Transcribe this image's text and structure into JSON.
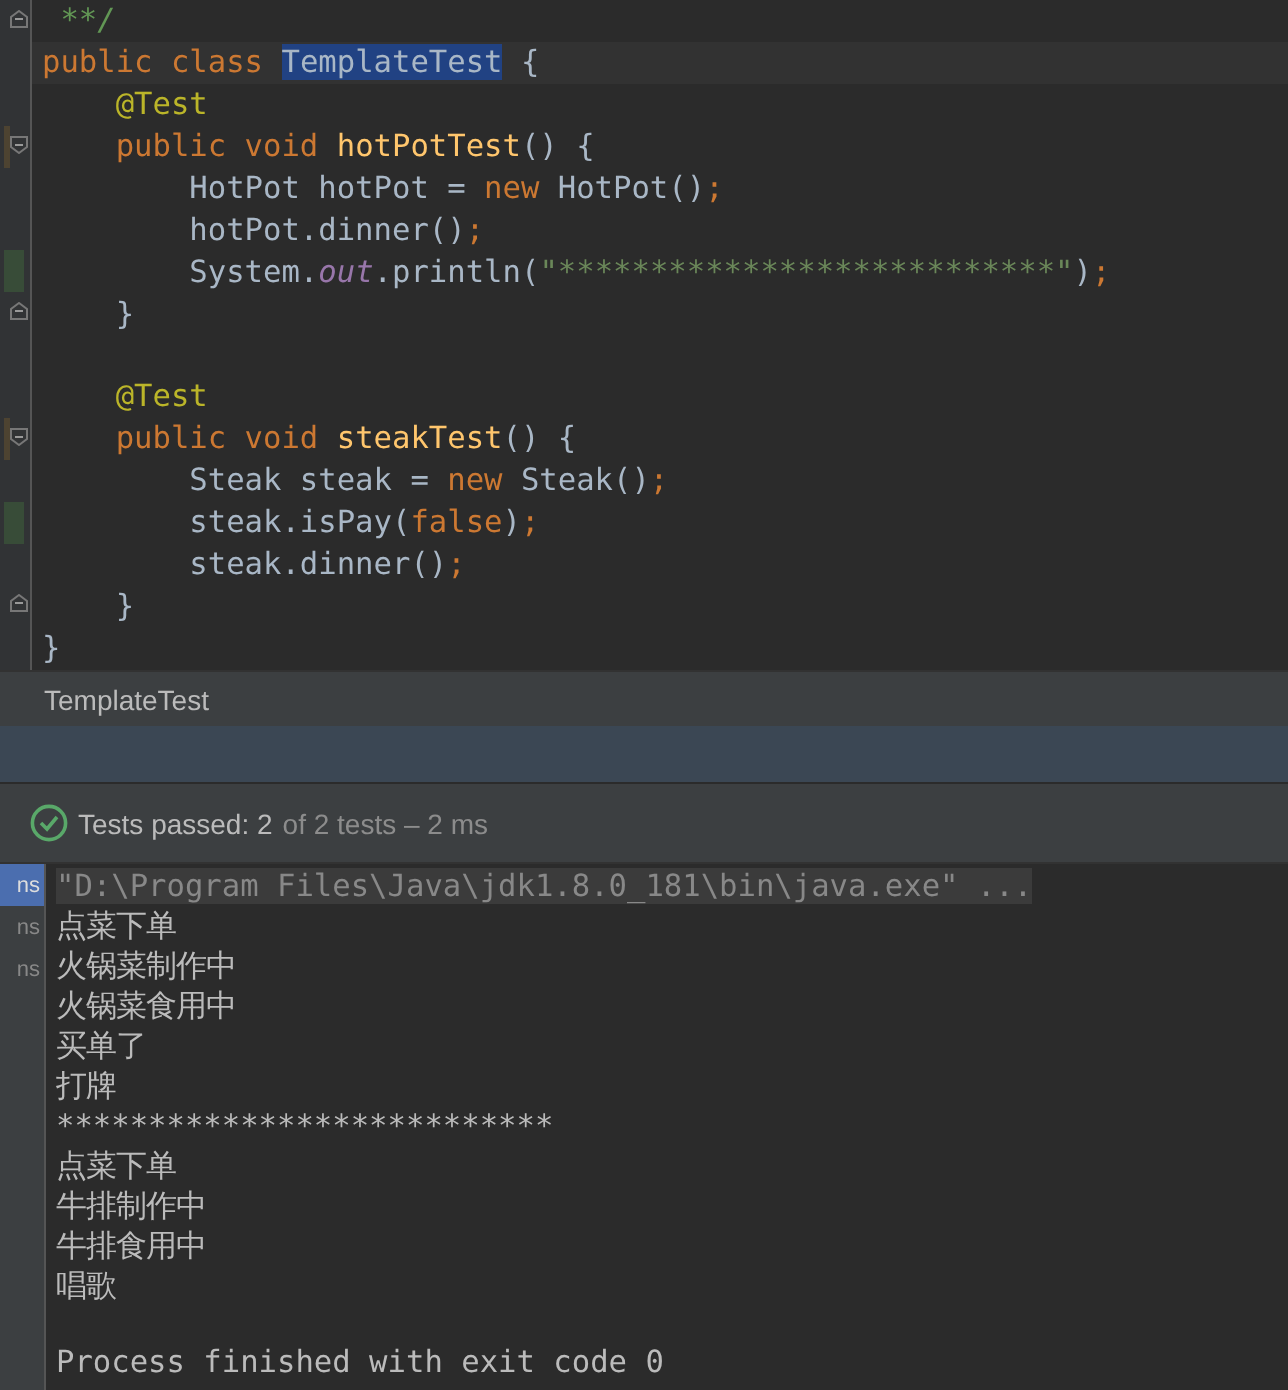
{
  "editor": {
    "lines": [
      {
        "current": false,
        "fold_start": false,
        "fold_end": true,
        "modified": false,
        "added": false,
        "tokens": [
          {
            "kind": "comment",
            "text": " **/"
          }
        ]
      },
      {
        "current": true,
        "fold_start": false,
        "fold_end": false,
        "modified": false,
        "added": false,
        "tokens": [
          {
            "kind": "kw",
            "text": "public class "
          },
          {
            "kind": "selected",
            "text": "TemplateTest"
          },
          {
            "kind": "plain",
            "text": " {"
          }
        ]
      },
      {
        "current": false,
        "fold_start": false,
        "fold_end": false,
        "modified": false,
        "added": false,
        "tokens": [
          {
            "kind": "annot",
            "text": "    @Test"
          }
        ]
      },
      {
        "current": false,
        "fold_start": true,
        "fold_end": false,
        "modified": true,
        "added": false,
        "tokens": [
          {
            "kind": "kw",
            "text": "    public void "
          },
          {
            "kind": "fn",
            "text": "hotPotTest"
          },
          {
            "kind": "plain",
            "text": "() {"
          }
        ]
      },
      {
        "current": false,
        "fold_start": false,
        "fold_end": false,
        "modified": false,
        "added": false,
        "tokens": [
          {
            "kind": "plain",
            "text": "        HotPot hotPot = "
          },
          {
            "kind": "kw",
            "text": "new "
          },
          {
            "kind": "plain",
            "text": "HotPot()"
          },
          {
            "kind": "kw",
            "text": ";"
          }
        ]
      },
      {
        "current": false,
        "fold_start": false,
        "fold_end": false,
        "modified": false,
        "added": false,
        "tokens": [
          {
            "kind": "plain",
            "text": "        hotPot.dinner()"
          },
          {
            "kind": "kw",
            "text": ";"
          }
        ]
      },
      {
        "current": false,
        "fold_start": false,
        "fold_end": false,
        "modified": false,
        "added": true,
        "tokens": [
          {
            "kind": "plain",
            "text": "        System."
          },
          {
            "kind": "field",
            "text": "out"
          },
          {
            "kind": "plain",
            "text": ".println("
          },
          {
            "kind": "str",
            "text": "\"***************************\""
          },
          {
            "kind": "plain",
            "text": ")"
          },
          {
            "kind": "kw",
            "text": ";"
          }
        ]
      },
      {
        "current": false,
        "fold_start": false,
        "fold_end": true,
        "modified": false,
        "added": false,
        "tokens": [
          {
            "kind": "plain",
            "text": "    }"
          }
        ]
      },
      {
        "current": false,
        "fold_start": false,
        "fold_end": false,
        "modified": false,
        "added": false
      },
      {
        "current": false,
        "fold_start": false,
        "fold_end": false,
        "modified": false,
        "added": false,
        "tokens": [
          {
            "kind": "annot",
            "text": "    @Test"
          }
        ]
      },
      {
        "current": false,
        "fold_start": true,
        "fold_end": false,
        "modified": true,
        "added": false,
        "tokens": [
          {
            "kind": "kw",
            "text": "    public void "
          },
          {
            "kind": "fn",
            "text": "steakTest"
          },
          {
            "kind": "plain",
            "text": "() {"
          }
        ]
      },
      {
        "current": false,
        "fold_start": false,
        "fold_end": false,
        "modified": false,
        "added": false,
        "tokens": [
          {
            "kind": "plain",
            "text": "        Steak steak = "
          },
          {
            "kind": "kw",
            "text": "new "
          },
          {
            "kind": "plain",
            "text": "Steak()"
          },
          {
            "kind": "kw",
            "text": ";"
          }
        ]
      },
      {
        "current": false,
        "fold_start": false,
        "fold_end": false,
        "modified": false,
        "added": true,
        "tokens": [
          {
            "kind": "plain",
            "text": "        steak.isPay("
          },
          {
            "kind": "kw",
            "text": "false"
          },
          {
            "kind": "plain",
            "text": ")"
          },
          {
            "kind": "kw",
            "text": ";"
          }
        ]
      },
      {
        "current": false,
        "fold_start": false,
        "fold_end": false,
        "modified": false,
        "added": false,
        "tokens": [
          {
            "kind": "plain",
            "text": "        steak.dinner()"
          },
          {
            "kind": "kw",
            "text": ";"
          }
        ]
      },
      {
        "current": false,
        "fold_start": false,
        "fold_end": true,
        "modified": false,
        "added": false,
        "tokens": [
          {
            "kind": "plain",
            "text": "    }"
          }
        ]
      },
      {
        "current": false,
        "fold_start": false,
        "fold_end": false,
        "modified": false,
        "added": false,
        "tokens": [
          {
            "kind": "plain",
            "text": "}"
          }
        ]
      }
    ],
    "breadcrumb": "TemplateTest"
  },
  "run": {
    "status": "Tests passed: 2",
    "detail": "of 2 tests – 2 ms",
    "side_tabs": [
      {
        "label": "ns",
        "selected": true
      },
      {
        "label": "ns",
        "selected": false
      },
      {
        "label": "ns",
        "selected": false
      }
    ],
    "console": [
      {
        "kind": "command",
        "text": "\"D:\\Program Files\\Java\\jdk1.8.0_181\\bin\\java.exe\" ..."
      },
      {
        "kind": "output",
        "text": "点菜下单"
      },
      {
        "kind": "output",
        "text": "火锅菜制作中"
      },
      {
        "kind": "output",
        "text": "火锅菜食用中"
      },
      {
        "kind": "output",
        "text": "买单了"
      },
      {
        "kind": "output",
        "text": "打牌"
      },
      {
        "kind": "output",
        "text": "***************************"
      },
      {
        "kind": "output",
        "text": "点菜下单"
      },
      {
        "kind": "output",
        "text": "牛排制作中"
      },
      {
        "kind": "output",
        "text": "牛排食用中"
      },
      {
        "kind": "output",
        "text": "唱歌"
      },
      {
        "kind": "exit",
        "text": "Process finished with exit code 0"
      }
    ]
  }
}
